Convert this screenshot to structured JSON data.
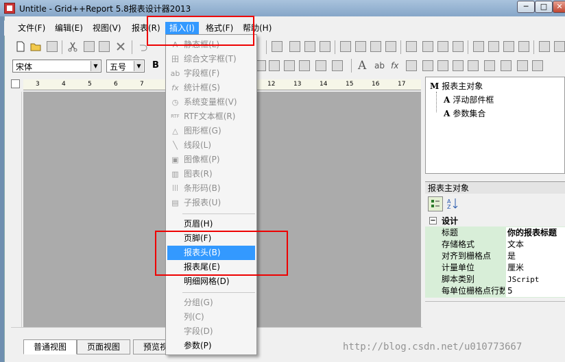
{
  "window": {
    "title": "Untitle - Grid++Report 5.8报表设计器2013",
    "buttons": [
      "─",
      "□",
      "✕"
    ]
  },
  "menubar": [
    "文件(F)",
    "编辑(E)",
    "视图(V)",
    "报表(R)",
    "插入(I)",
    "格式(F)",
    "帮助(H)"
  ],
  "active_menu": "插入(I)",
  "format_toolbar": {
    "font_name": "宋体",
    "font_size": "五号",
    "bold_label": "B"
  },
  "ruler": {
    "marks": [
      "3",
      "4",
      "5",
      "6",
      "7",
      "12",
      "13",
      "14",
      "15",
      "16",
      "17"
    ]
  },
  "insert_menu": {
    "group1": [
      {
        "label": "静态框(L)",
        "icon": "static-text-icon",
        "glyph": "A"
      },
      {
        "label": "综合文字框(T)",
        "icon": "memo-box-icon",
        "glyph": "田"
      },
      {
        "label": "字段框(F)",
        "icon": "field-box-icon",
        "glyph": "ab"
      },
      {
        "label": "统计框(S)",
        "icon": "summary-box-icon",
        "glyph": "fx"
      },
      {
        "label": "系统变量框(V)",
        "icon": "system-var-icon",
        "glyph": "◷"
      },
      {
        "label": "RTF文本框(R)",
        "icon": "rtf-box-icon",
        "glyph": "RTF"
      },
      {
        "label": "图形框(G)",
        "icon": "shape-box-icon",
        "glyph": "△"
      },
      {
        "label": "线段(L)",
        "icon": "line-icon",
        "glyph": "╲"
      },
      {
        "label": "图像框(P)",
        "icon": "picture-box-icon",
        "glyph": "▣"
      },
      {
        "label": "图表(R)",
        "icon": "chart-icon",
        "glyph": "▥"
      },
      {
        "label": "条形码(B)",
        "icon": "barcode-icon",
        "glyph": "|||"
      },
      {
        "label": "子报表(U)",
        "icon": "subreport-icon",
        "glyph": "▤"
      }
    ],
    "group2": [
      "页眉(H)",
      "页脚(F)",
      "报表头(B)",
      "报表尾(E)",
      "明细网格(D)"
    ],
    "highlighted": "报表头(B)",
    "group3": [
      "分组(G)",
      "列(C)",
      "字段(D)",
      "参数(P)"
    ]
  },
  "object_tree": {
    "root": "报表主对象",
    "children": [
      "浮动部件框",
      "参数集合"
    ]
  },
  "property_panel": {
    "header": "报表主对象",
    "category": "设计",
    "rows": [
      {
        "name": "标题",
        "value": "你的报表标题"
      },
      {
        "name": "存储格式",
        "value": "文本"
      },
      {
        "name": "对齐到栅格点",
        "value": "是"
      },
      {
        "name": "计量单位",
        "value": "厘米"
      },
      {
        "name": "脚本类别",
        "value": "JScript"
      },
      {
        "name": "每单位栅格点行数",
        "value": "5"
      }
    ]
  },
  "view_tabs": [
    "普通视图",
    "页面视图",
    "预览视"
  ],
  "watermark": "http://blog.csdn.net/u010773667",
  "colors": {
    "highlight": "#3399ff",
    "annotation": "#e00000",
    "property_bg": "#d8eed8"
  }
}
